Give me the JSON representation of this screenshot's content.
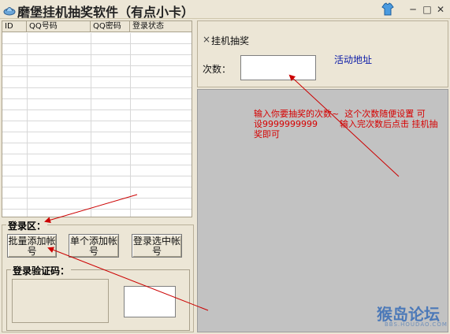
{
  "window": {
    "title": "磨堡挂机抽奖软件（有点小卡）",
    "minimize_glyph": "─",
    "maximize_glyph": "□",
    "close_glyph": "✕"
  },
  "table": {
    "columns": [
      "ID",
      "QQ号码",
      "QQ密码",
      "登录状态"
    ],
    "rows": []
  },
  "login_area": {
    "label": "登录区：",
    "batch_add_button": "批量添加帐号",
    "single_add_button": "单个添加帐号",
    "login_selected_button": "登录选中帐号",
    "captcha_label": "登录验证码："
  },
  "right_panel": {
    "tab_close_glyph": "×",
    "tab_label": "挂机抽奖",
    "count_label": "次数：",
    "count_value": "",
    "activity_link": "活动地址"
  },
  "annotation": {
    "line1": "输入你要抽奖的次数~  这个次数随便设置 可",
    "line2": "设9999999999        输入完次数后点击 挂机抽",
    "line3": "奖即可"
  },
  "watermark": {
    "main": "猴岛论坛",
    "sub": "BBS.HOUDAO.COM"
  },
  "colors": {
    "background": "#ece6d6",
    "annotation_red": "#d60000",
    "link_blue": "#0a1aa8",
    "browser_gray": "#c2c2c2"
  }
}
